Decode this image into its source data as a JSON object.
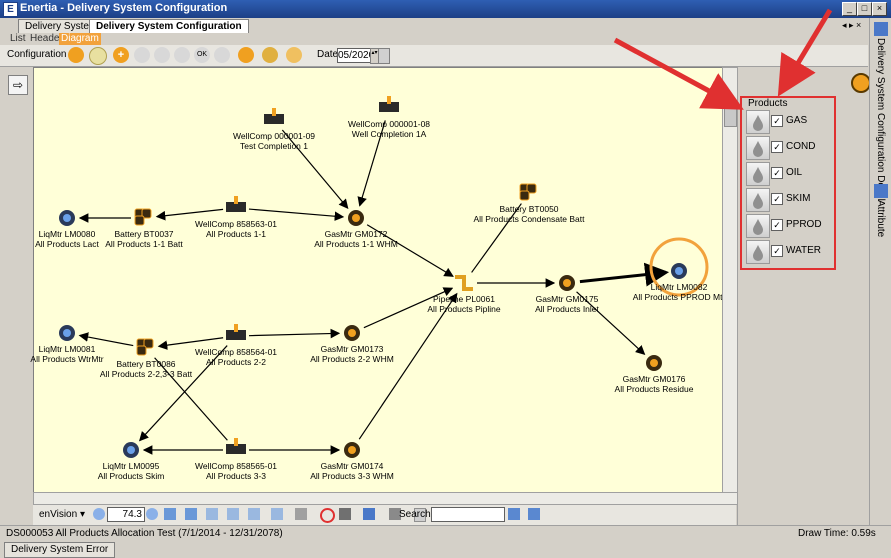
{
  "window": {
    "title": "Enertia - Delivery System Configuration"
  },
  "tabs": [
    {
      "label": "Delivery System"
    },
    {
      "label": "Delivery System Configuration"
    }
  ],
  "view_tabs": [
    {
      "label": "List"
    },
    {
      "label": "Header"
    },
    {
      "label": "Diagram"
    }
  ],
  "toolbar": {
    "configuration_label": "Configuration",
    "date_label": "Date",
    "date_value": "05/2020"
  },
  "diagram": {
    "nodes": [
      {
        "id": "wellcomp_000001_09",
        "type": "well",
        "line1": "WellComp 000001-09",
        "line2": "Test Completion 1"
      },
      {
        "id": "wellcomp_000001_08",
        "type": "well",
        "line1": "WellComp 000001-08",
        "line2": "Well Completion 1A"
      },
      {
        "id": "liqmtr_lm0080",
        "type": "liquid",
        "line1": "LiqMtr LM0080",
        "line2": "All Products Lact"
      },
      {
        "id": "battery_bt0037",
        "type": "battery",
        "line1": "Battery BT0037",
        "line2": "All Products 1-1 Batt"
      },
      {
        "id": "wellcomp_858563_01",
        "type": "well",
        "line1": "WellComp 858563-01",
        "line2": "All Products 1-1"
      },
      {
        "id": "gasmtr_gm0172",
        "type": "gas",
        "line1": "GasMtr GM0172",
        "line2": "All Products 1-1 WHM"
      },
      {
        "id": "battery_bt0050",
        "type": "battery",
        "line1": "Battery BT0050",
        "line2": "All Products Condensate Batt"
      },
      {
        "id": "pipeline_pl0061",
        "type": "pipe",
        "line1": "Pipeline PL0061",
        "line2": "All Products Pipline"
      },
      {
        "id": "gasmtr_gm0175",
        "type": "gas",
        "line1": "GasMtr GM0175",
        "line2": "All Products Inlet"
      },
      {
        "id": "liqmtr_lm0082",
        "type": "liquid",
        "line1": "LiqMtr LM0082",
        "line2": "All Products PPROD Mtr"
      },
      {
        "id": "liqmtr_lm0081",
        "type": "liquid",
        "line1": "LiqMtr LM0081",
        "line2": "All Products WtrMtr"
      },
      {
        "id": "battery_bt0086",
        "type": "battery",
        "line1": "Battery BT0086",
        "line2": "All Products 2-2,3-3 Batt"
      },
      {
        "id": "wellcomp_858564_01",
        "type": "well",
        "line1": "WellComp 858564-01",
        "line2": "All Products 2-2"
      },
      {
        "id": "gasmtr_gm0173",
        "type": "gas",
        "line1": "GasMtr GM0173",
        "line2": "All Products 2-2 WHM"
      },
      {
        "id": "gasmtr_gm0176",
        "type": "gas",
        "line1": "GasMtr GM0176",
        "line2": "All Products Residue"
      },
      {
        "id": "liqmtr_lm0095",
        "type": "liquid",
        "line1": "LiqMtr LM0095",
        "line2": "All Products Skim"
      },
      {
        "id": "wellcomp_858565_01",
        "type": "well",
        "line1": "WellComp 858565-01",
        "line2": "All Products 3-3"
      },
      {
        "id": "gasmtr_gm0174",
        "type": "gas",
        "line1": "GasMtr GM0174",
        "line2": "All Products 3-3 WHM"
      }
    ]
  },
  "bottom_toolbar": {
    "envision_label": "enVision",
    "zoom_value": "74.3",
    "search_label": "Search:",
    "search_value": ""
  },
  "status": {
    "left": "DS000053 All Products Allocation Test (7/1/2014 - 12/31/2078)",
    "right": "Draw Time: 0.59s"
  },
  "bottom_tab": {
    "label": "Delivery System Error"
  },
  "products_panel": {
    "title": "Products",
    "items": [
      {
        "label": "GAS",
        "checked": true
      },
      {
        "label": "COND",
        "checked": true
      },
      {
        "label": "OIL",
        "checked": true
      },
      {
        "label": "SKIM",
        "checked": true
      },
      {
        "label": "PPROD",
        "checked": true
      },
      {
        "label": "WATER",
        "checked": true
      }
    ]
  },
  "side_tabs": [
    {
      "label": "Delivery System Configuration Detail"
    },
    {
      "label": "Attribute"
    }
  ],
  "colors": {
    "accent": "#f2a23c",
    "highlight_border": "#e03030",
    "canvas": "#ffffd8",
    "arrow": "#e03030"
  }
}
